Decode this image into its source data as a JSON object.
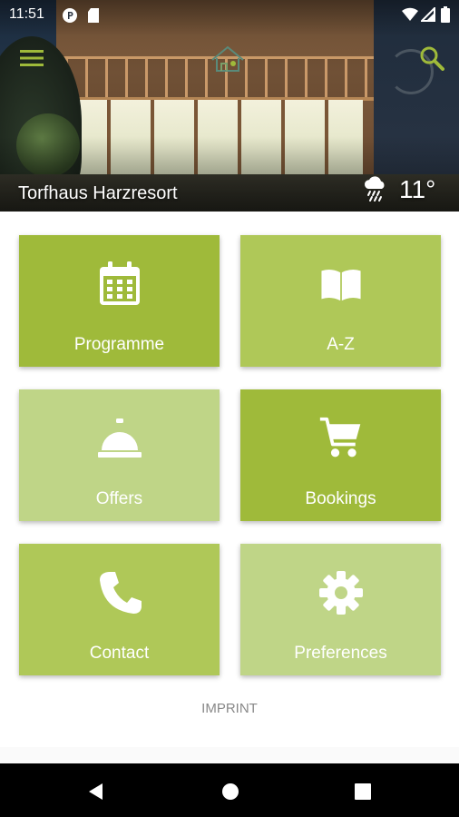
{
  "status_bar": {
    "time": "11:51",
    "icons": [
      "notification-p-icon",
      "sd-card-icon",
      "wifi-icon",
      "signal-icon",
      "battery-icon"
    ]
  },
  "header": {
    "hotel_name": "Torfhaus Harzresort",
    "temperature": "11°",
    "weather_icon": "cloud-rain-icon",
    "accent_color": "#9fba3a"
  },
  "tiles": [
    {
      "label": "Programme",
      "icon": "calendar-icon",
      "color": "#9fba3a"
    },
    {
      "label": "A-Z",
      "icon": "book-open-icon",
      "color": "#afc858"
    },
    {
      "label": "Offers",
      "icon": "service-bell-icon",
      "color": "#bfd587"
    },
    {
      "label": "Bookings",
      "icon": "shopping-cart-icon",
      "color": "#9fba3a"
    },
    {
      "label": "Contact",
      "icon": "phone-icon",
      "color": "#afc858"
    },
    {
      "label": "Preferences",
      "icon": "gear-icon",
      "color": "#bfd587"
    }
  ],
  "footer": {
    "imprint_label": "IMPRINT"
  },
  "nav": {
    "buttons": [
      "back-icon",
      "home-icon",
      "recent-apps-icon"
    ]
  }
}
